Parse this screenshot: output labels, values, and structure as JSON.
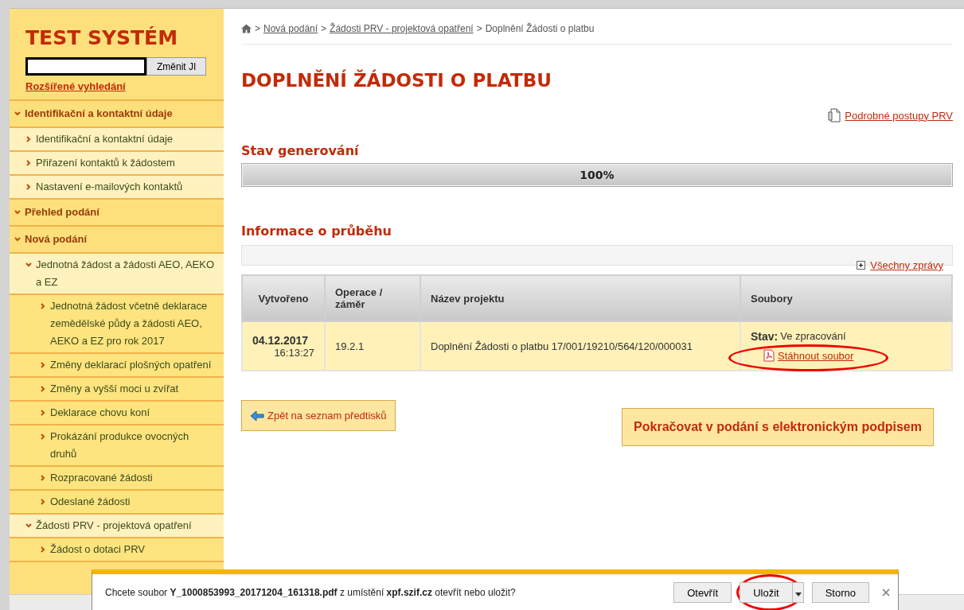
{
  "sidebar": {
    "title": "TEST SYSTÉM",
    "search": {
      "button": "Změnit JI"
    },
    "advanced_link": "Rozšířené vyhledání",
    "items": [
      {
        "label": "Identifikační a kontaktní údaje",
        "expanded": true,
        "children": [
          {
            "label": "Identifikační a kontaktní údaje",
            "expanded": false
          },
          {
            "label": "Přiřazení kontaktů k žádostem",
            "expanded": false
          },
          {
            "label": "Nastavení e-mailových kontaktů",
            "expanded": false
          }
        ]
      },
      {
        "label": "Přehled podání",
        "expanded": true
      },
      {
        "label": "Nová podání",
        "expanded": true,
        "children": [
          {
            "label": "Jednotná žádost a žádosti AEO, AEKO a EZ",
            "expanded": true,
            "children": [
              {
                "label": "Jednotná žádost včetně deklarace zemědělské půdy a žádosti AEO, AEKO a EZ pro rok 2017",
                "expanded": false
              },
              {
                "label": "Změny deklarací plošných opatření",
                "expanded": false
              },
              {
                "label": "Změny a vyšší moci u zvířat",
                "expanded": false
              },
              {
                "label": "Deklarace chovu koní",
                "expanded": false
              },
              {
                "label": "Prokázání produkce ovocných druhů",
                "expanded": false
              },
              {
                "label": "Rozpracované žádosti",
                "expanded": false
              },
              {
                "label": "Odeslané žádosti",
                "expanded": false
              }
            ]
          },
          {
            "label": "Žádosti PRV - projektová opatření",
            "expanded": true,
            "children": [
              {
                "label": "Žádost o dotaci PRV",
                "expanded": false
              }
            ]
          }
        ]
      }
    ]
  },
  "breadcrumb": {
    "separator": ">",
    "items": [
      {
        "label": "Nová podání",
        "link": true
      },
      {
        "label": "Žádosti PRV - projektová opatření",
        "link": true
      },
      {
        "label": "Doplnění Žádosti o platbu",
        "link": false
      }
    ]
  },
  "title": "DOPLNĚNÍ ŽÁDOSTI O PLATBU",
  "help_link": "Podrobné postupy PRV",
  "generation": {
    "heading": "Stav generování",
    "level": 1.0,
    "reading": "100%"
  },
  "progress_info": {
    "heading": "Informace o průběhu",
    "all_messages": "Všechny zprávy"
  },
  "table": {
    "columns": [
      "Vytvořeno",
      "Operace / záměr",
      "Název projektu",
      "Soubory"
    ],
    "rows": [
      {
        "date": "04.12.2017",
        "time": "16:13:27",
        "operation": "19.2.1",
        "project": "Doplnění Žádosti o platbu 17/001/19210/564/120/000031",
        "status_label": "Stav:",
        "status": "Ve zpracování",
        "file_link": "Stáhnout soubor"
      }
    ]
  },
  "back_button": "Zpět na seznam předtisků",
  "continue_button": "Pokračovat v podání s elektronickým podpisem",
  "download_bar": {
    "message": "Chcete soubor **Y_1000853993_20171204_161318.pdf** z umístění **xpf.szif.cz** otevřít nebo uložit?",
    "buttons": [
      "Otevřít",
      "Uložit",
      "Storno"
    ]
  }
}
